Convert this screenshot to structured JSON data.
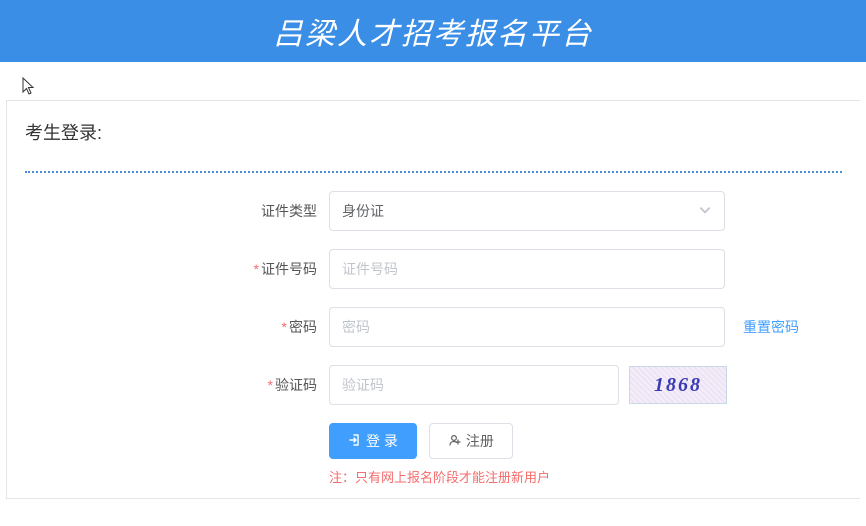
{
  "header": {
    "title": "吕梁人才招考报名平台"
  },
  "panel": {
    "title": "考生登录:",
    "fields": {
      "idType": {
        "label": "证件类型",
        "value": "身份证"
      },
      "idNumber": {
        "label": "证件号码",
        "placeholder": "证件号码"
      },
      "password": {
        "label": "密码",
        "placeholder": "密码",
        "resetLink": "重置密码"
      },
      "captcha": {
        "label": "验证码",
        "placeholder": "验证码",
        "image": "1868"
      }
    },
    "buttons": {
      "login": "登 录",
      "register": "注册"
    },
    "note": "注：只有网上报名阶段才能注册新用户"
  }
}
